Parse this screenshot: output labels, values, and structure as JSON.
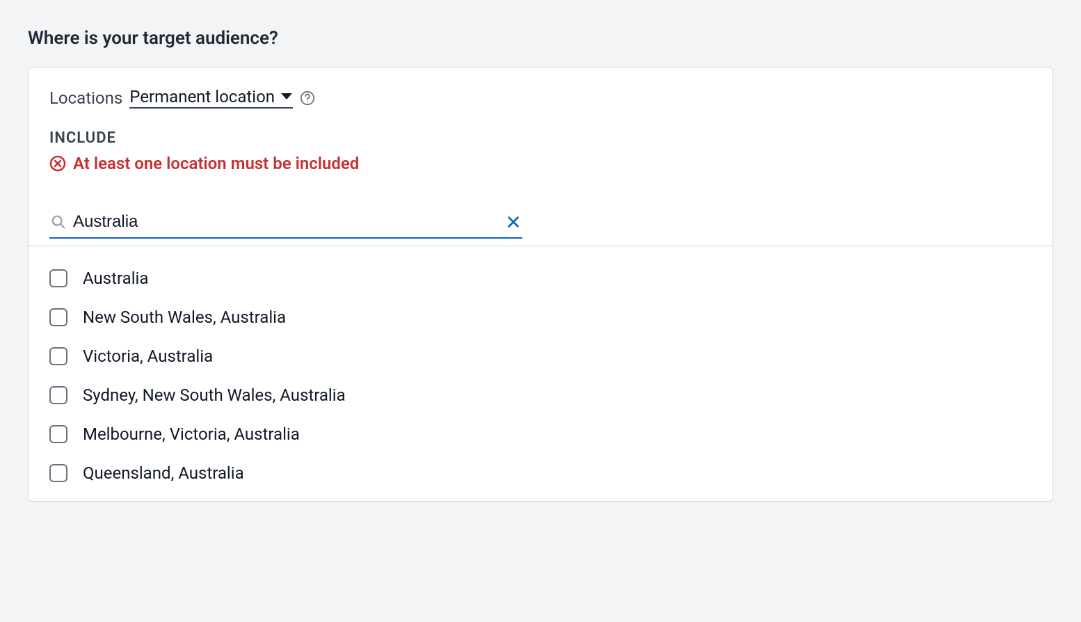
{
  "page": {
    "title": "Where is your target audience?"
  },
  "locations": {
    "label": "Locations",
    "type_selected": "Permanent location"
  },
  "include": {
    "label": "INCLUDE",
    "error": "At least one location must be included"
  },
  "search": {
    "value": "Australia",
    "placeholder": ""
  },
  "options": [
    {
      "label": "Australia"
    },
    {
      "label": "New South Wales, Australia"
    },
    {
      "label": "Victoria, Australia"
    },
    {
      "label": "Sydney, New South Wales, Australia"
    },
    {
      "label": "Melbourne, Victoria, Australia"
    },
    {
      "label": "Queensland, Australia"
    }
  ]
}
